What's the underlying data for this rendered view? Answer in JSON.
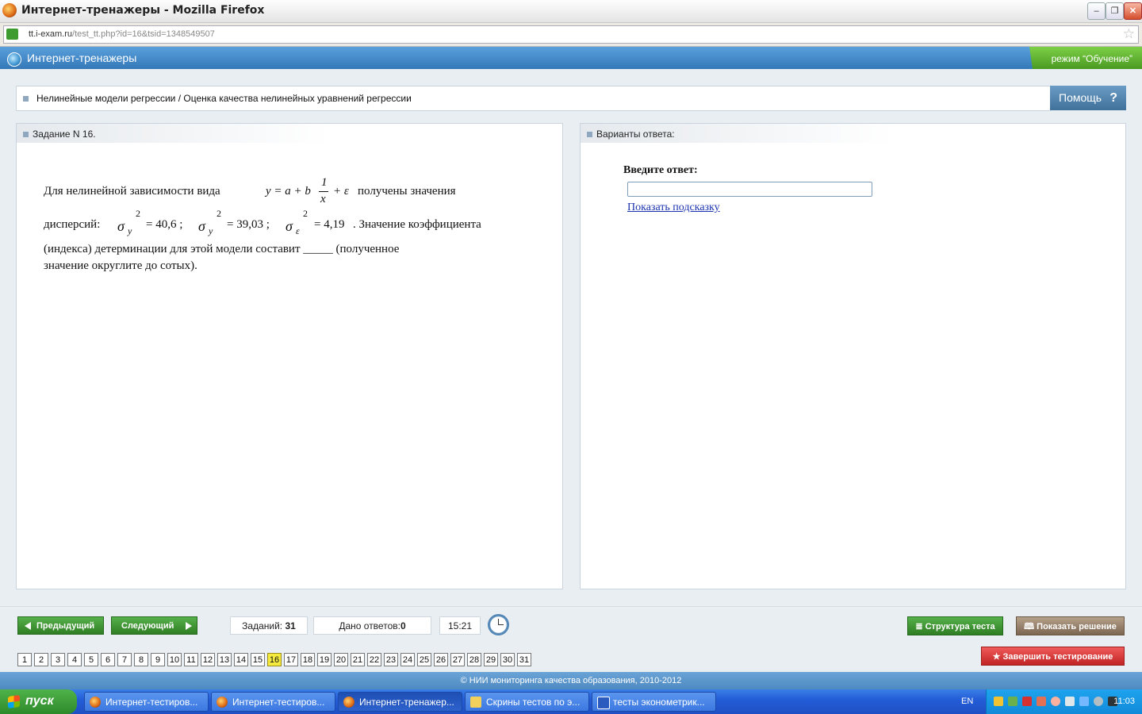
{
  "window": {
    "title": "Интернет-тренажеры - Mozilla Firefox"
  },
  "browser": {
    "url_host": "tt.i-exam.ru",
    "url_path": "/test_tt.php?id=16&tsid=1348549507"
  },
  "site": {
    "title": "Интернет-тренажеры",
    "mode": "режим “Обучение”"
  },
  "breadcrumb": "Нелинейные модели регрессии / Оценка качества нелинейных уравнений регрессии",
  "help_label": "Помощь",
  "help_mark": "?",
  "task": {
    "heading": "Задание N 16.",
    "line1_a": "Для нелинейной зависимости вида",
    "formula": "y = a + b",
    "frac_num": "1",
    "frac_den": "x",
    "formula_end": "+ ε",
    "line1_b": "получены значения",
    "line2_a": "дисперсий:",
    "var_y": "σ",
    "var_y_sub": "y",
    "var_y_sup": "2",
    "var_y_val": "= 40,6 ;",
    "var_yhat": "σ",
    "var_yhat_sub": "y",
    "var_yhat_sup": "2",
    "var_yhat_val": "= 39,03 ;",
    "var_e": "σ",
    "var_e_sub": "ε",
    "var_e_sup": "2",
    "var_e_val": "= 4,19",
    "line2_b": ". Значение коэффициента",
    "line3": "(индекса) детерминации для этой модели составит _____ (полученное",
    "line4": "значение округлите до сотых)."
  },
  "answer": {
    "heading": "Варианты ответа:",
    "label": "Введите ответ:",
    "input_value": "",
    "hint_link": "Показать подсказку"
  },
  "nav": {
    "prev": "Предыдущий",
    "next": "Следующий",
    "tasks_label": "Заданий:",
    "tasks_count": "31",
    "answers_label": "Дано ответов:",
    "answers_count": "0",
    "timer": "15:21",
    "structure": "Структура теста",
    "show_solution": "Показать решение",
    "finish": "Завершить тестирование",
    "pages": [
      "1",
      "2",
      "3",
      "4",
      "5",
      "6",
      "7",
      "8",
      "9",
      "10",
      "11",
      "12",
      "13",
      "14",
      "15",
      "16",
      "17",
      "18",
      "19",
      "20",
      "21",
      "22",
      "23",
      "24",
      "25",
      "26",
      "27",
      "28",
      "29",
      "30",
      "31"
    ],
    "current_page": "16"
  },
  "footer": "© НИИ мониторинга качества образования, 2010-2012",
  "taskbar": {
    "start": "пуск",
    "tasks": [
      {
        "label": "Интернет-тестиров...",
        "icon": "firefox-icon",
        "active": false
      },
      {
        "label": "Интернет-тестиров...",
        "icon": "firefox-icon",
        "active": false
      },
      {
        "label": "Интернет-тренажер...",
        "icon": "firefox-icon",
        "active": true
      },
      {
        "label": "Скрины тестов по э...",
        "icon": "folder-icon",
        "active": false
      },
      {
        "label": "тесты эконометрик...",
        "icon": "word-icon",
        "active": false
      }
    ],
    "lang": "EN",
    "time": "11:03"
  },
  "colors": {
    "accent": "#3478b8",
    "green": "#2f7d24",
    "current_page": "#f5ea3d"
  }
}
